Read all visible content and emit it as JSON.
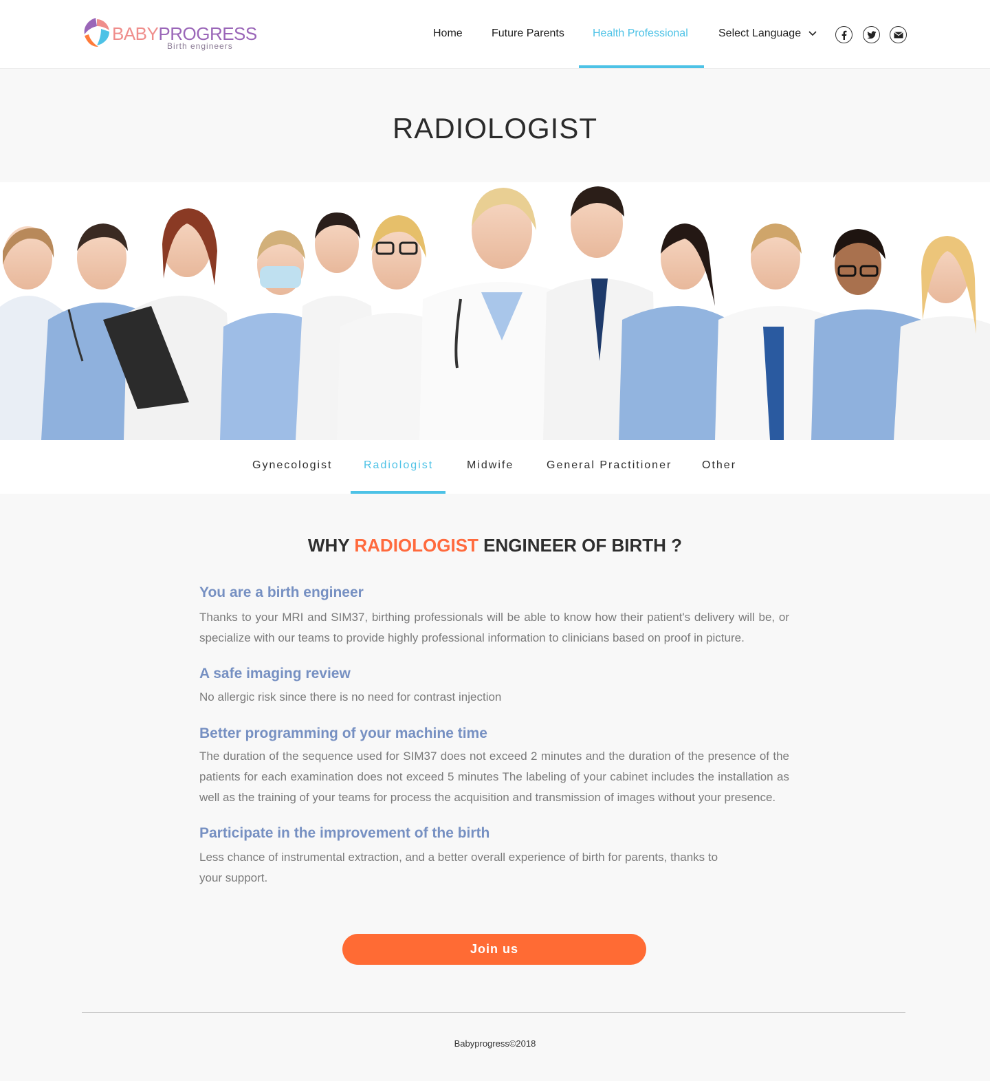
{
  "header": {
    "logo_baby": "BABY",
    "logo_progress": "PROGRESS",
    "logo_tagline": "Birth engineers",
    "nav": [
      {
        "label": "Home"
      },
      {
        "label": "Future Parents"
      },
      {
        "label": "Health Professional",
        "active": true
      }
    ],
    "language_label": "Select Language",
    "social_icons": [
      "facebook-icon",
      "twitter-icon",
      "mail-icon"
    ]
  },
  "page_title": "RADIOLOGIST",
  "hero_image_alt": "medical team",
  "subtabs": [
    {
      "label": "Gynecologist"
    },
    {
      "label": "Radiologist",
      "active": true
    },
    {
      "label": "Midwife"
    },
    {
      "label": "General Practitioner"
    },
    {
      "label": "Other"
    }
  ],
  "section": {
    "heading_pre": "WHY",
    "heading_accent": "RADIOLOGIST",
    "heading_post": "ENGINEER OF BIRTH ?",
    "blocks": [
      {
        "title": "You are a birth engineer",
        "text": "Thanks to your MRI and SIM37, birthing professionals will be able to know how their patient's delivery will be, or specialize with our teams to provide highly professional information to clinicians based on proof in picture."
      },
      {
        "title": "A safe imaging review",
        "text": "No allergic risk since there is no need for contrast injection"
      },
      {
        "title": "Better programming of your machine time",
        "text": "The duration of the sequence used for SIM37 does not exceed 2 minutes and the duration of the presence of the patients for each examination does not exceed 5 minutes The labeling of your cabinet includes the installation as well as the training of your teams for process the acquisition and transmission of images without your presence."
      },
      {
        "title": "Participate in the improvement of the birth",
        "text": "Less chance of instrumental extraction, and a better overall experience of birth for parents, thanks to your support."
      }
    ]
  },
  "join_button": "Join us",
  "footer": "Babyprogress©2018",
  "colors": {
    "accent_blue": "#4dc2e6",
    "accent_orange": "#ff6a3d",
    "title_blue": "#7690c2"
  }
}
